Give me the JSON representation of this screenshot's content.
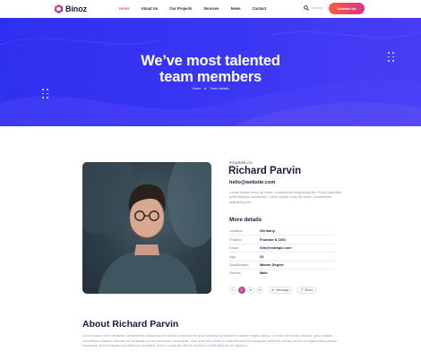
{
  "brand": {
    "name": "Binoz"
  },
  "nav": {
    "items": [
      {
        "label": "Home",
        "active": true
      },
      {
        "label": "About Us",
        "active": false
      },
      {
        "label": "Our Projects",
        "active": false
      },
      {
        "label": "Services",
        "active": false
      },
      {
        "label": "News",
        "active": false
      },
      {
        "label": "Contact",
        "active": false
      }
    ],
    "search_label": "Search",
    "search_icon": "search-icon",
    "cta_label": "Contact Us"
  },
  "hero": {
    "title_line1": "We’ve most talented",
    "title_line2": "team members",
    "breadcrumb": [
      "Home",
      "Team details"
    ]
  },
  "profile": {
    "role": "FOUNDER-CO",
    "name": "Richard Parvin",
    "email": "hello@website.com",
    "bio": "Lorem ipsum dolor sit amet, consectetur adipiscing elit. Proin vulputate pellentesque consectet. Lorem ipsum dolor sit amet, consectetur adipiscing elit.",
    "more_title": "More details",
    "details": [
      {
        "label": "Location",
        "value": "Germany"
      },
      {
        "label": "Position",
        "value": "Founder & CEO"
      },
      {
        "label": "Email",
        "value": "info@example.com"
      },
      {
        "label": "Age",
        "value": "24"
      },
      {
        "label": "Qualification",
        "value": "Master Degree"
      },
      {
        "label": "Gender",
        "value": "Male"
      }
    ],
    "social": [
      {
        "name": "facebook-icon",
        "glyph": "f"
      },
      {
        "name": "instagram-icon",
        "glyph": "◎"
      },
      {
        "name": "linkedin-icon",
        "glyph": "in"
      },
      {
        "name": "email-icon",
        "glyph": "✉"
      }
    ],
    "message_label": "Message",
    "share_label": "Share"
  },
  "about": {
    "title": "About Richard Parvin",
    "text": "Lorem ipsum dolor sit amet, consectetur adipiscing elit sed do eiusmod tempor incididunt ut labore et dolore magna aliqua. Ut enim ad minim veniam, quis nostrud exercitation ullamco laboris nisi ut aliquip ex ea commodo consequat. Duis aute irure dolor in reprehenderit in voluptate velit esse cillum dolore eu fugiat nulla pariatur. Excepteur sint occaecat cupidatat non proident, sunt in culpa qui officia deserunt mollit anim id est laborum."
  },
  "colors": {
    "accent": "#ff5a45",
    "hero": "#3335f2",
    "heading": "#1a1a3d"
  }
}
